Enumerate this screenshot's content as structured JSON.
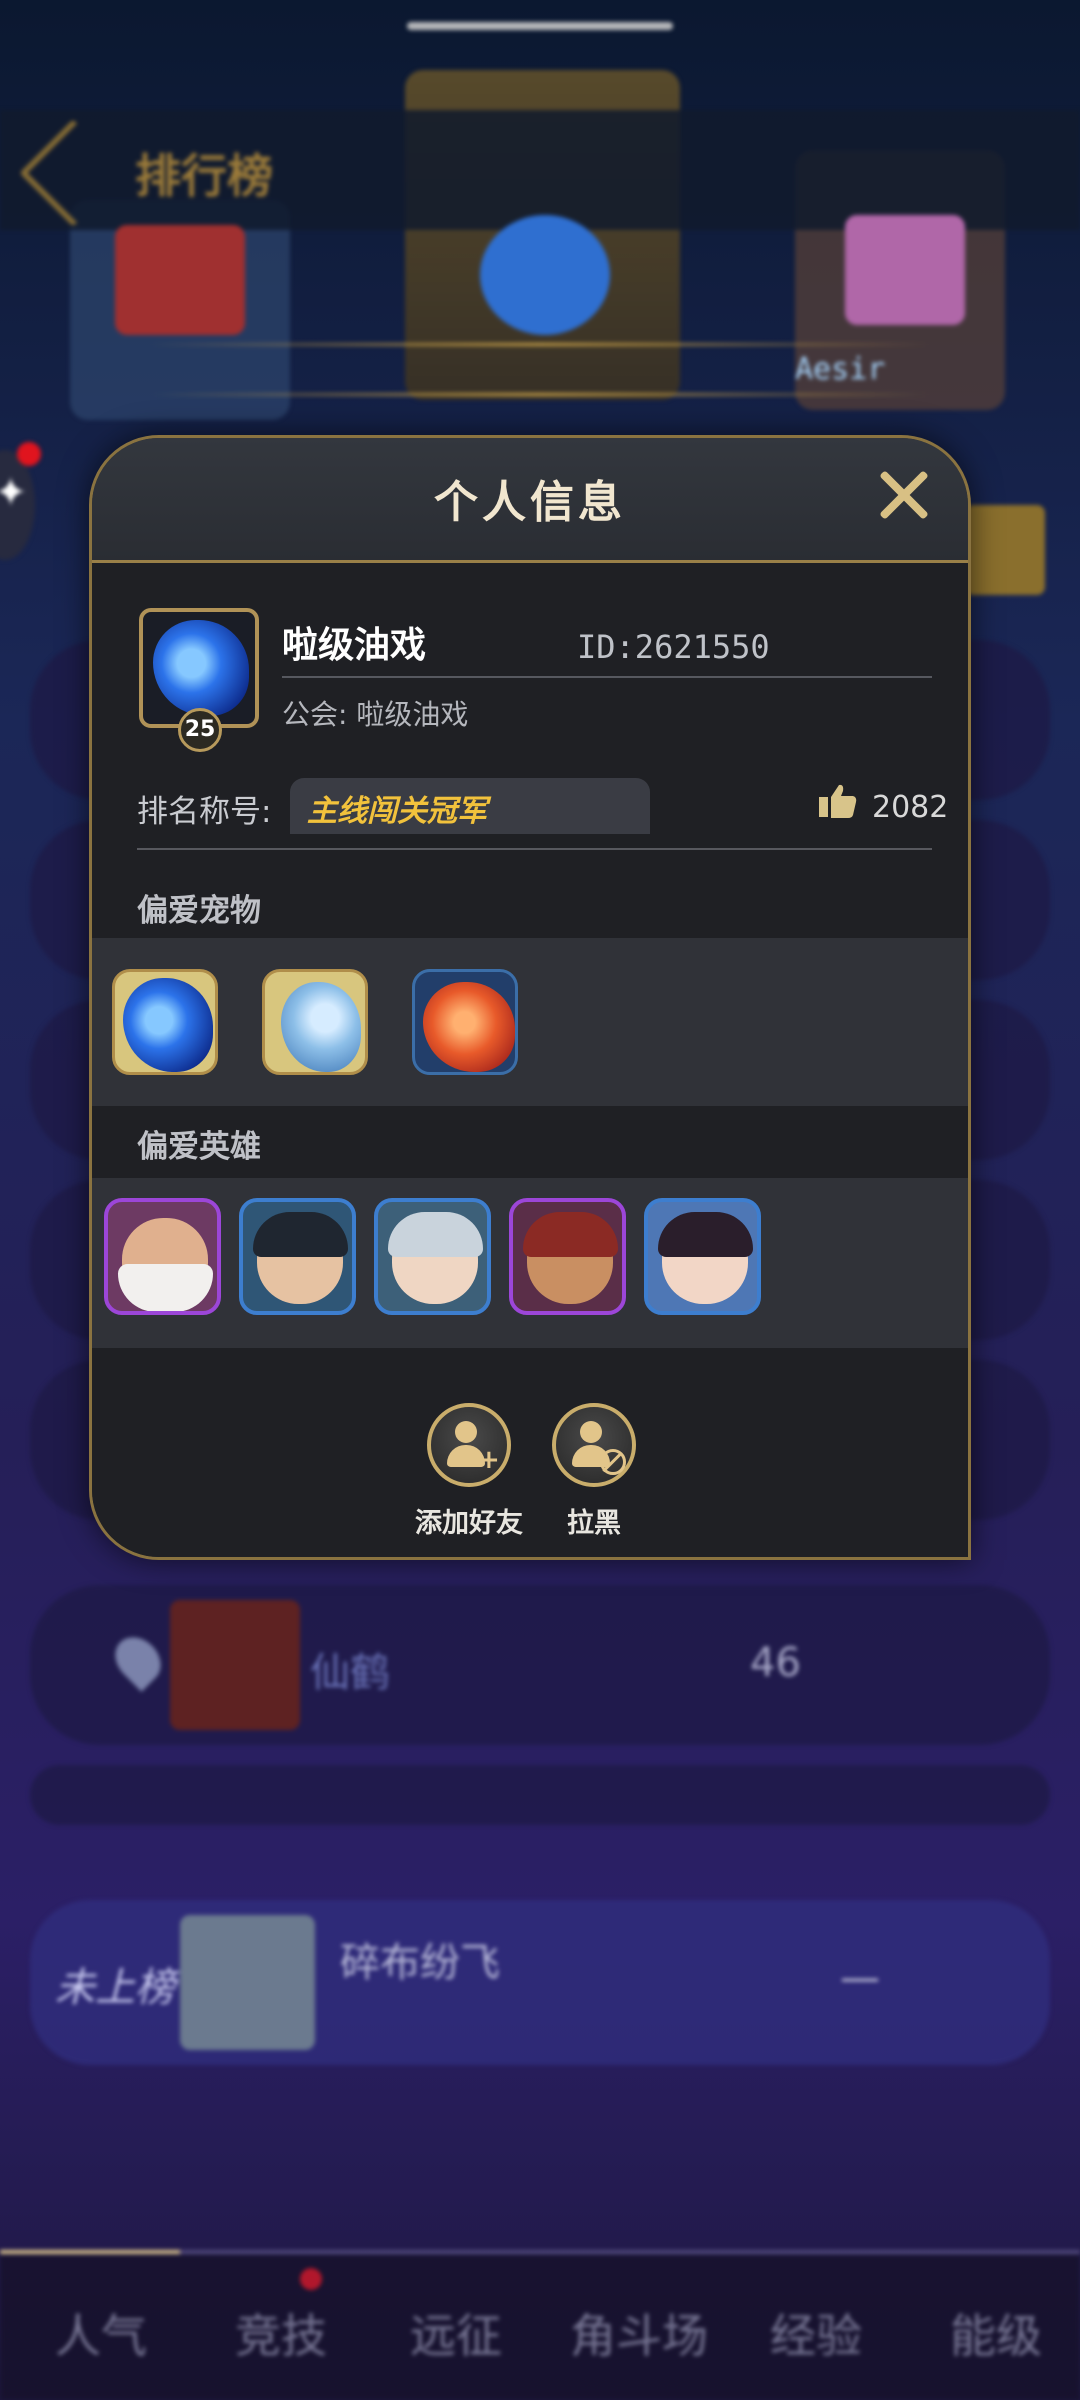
{
  "background": {
    "page_title": "排行榜",
    "top_player_name": "Aesir",
    "rows": [
      {
        "name": "仙鹤",
        "score": "46"
      }
    ],
    "my_row": {
      "tag": "未上榜",
      "name": "碎布纷飞",
      "score": "—"
    },
    "bottom_nav": [
      "人气",
      "竞技",
      "远征",
      "角斗场",
      "经验",
      "能级"
    ]
  },
  "dialog": {
    "title": "个人信息",
    "player": {
      "name": "啦级油戏",
      "id_text": "ID:2621550",
      "guild_text": "公会: 啦级油戏",
      "level": "25"
    },
    "rank": {
      "label": "排名称号:",
      "title": "主线闯关冠军"
    },
    "likes": "2082",
    "favorite_pets_label": "偏爱宠物",
    "favorite_heroes_label": "偏爱英雄",
    "actions": {
      "add_friend": "添加好友",
      "block": "拉黑"
    }
  },
  "colors": {
    "accent_gold": "#c9ad6b",
    "hero_purple": "#9c46d8",
    "hero_blue": "#3d7ecf",
    "rank_title_gold": "#f2c23c"
  },
  "icons": [
    "back-arrow-icon",
    "close-icon",
    "thumbs-up-icon",
    "add-friend-icon",
    "block-user-icon",
    "location-pin-icon"
  ]
}
